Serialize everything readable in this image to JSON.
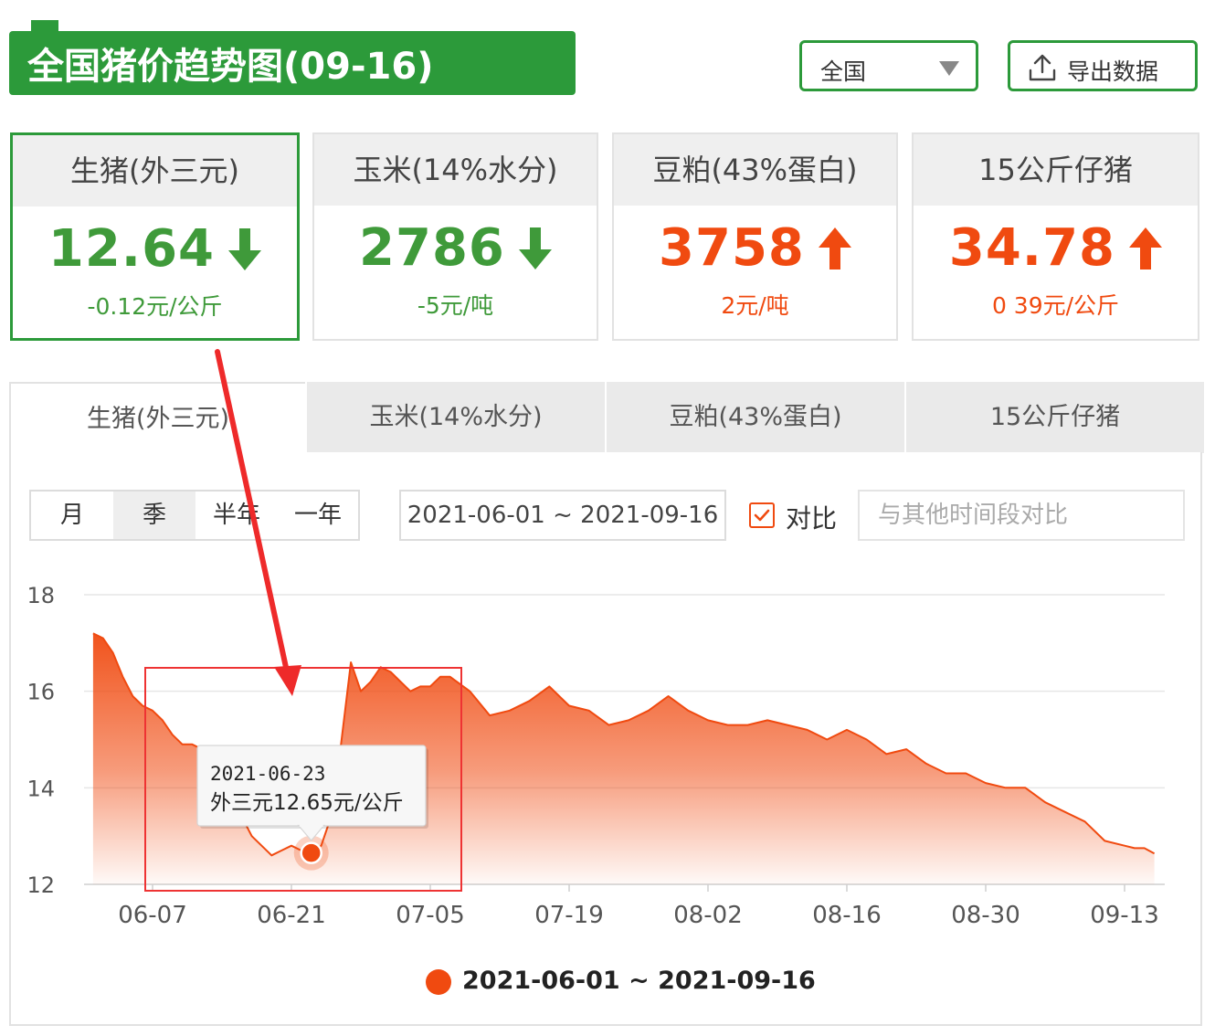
{
  "header": {
    "title": "全国猪价趋势图(09-16)",
    "region": "全国",
    "export_label": "导出数据"
  },
  "cards": [
    {
      "name": "生猪(外三元)",
      "value": "12.64",
      "change": "-0.12元/公斤",
      "direction": "down",
      "color": "#3f9a3a"
    },
    {
      "name": "玉米(14%水分)",
      "value": "2786",
      "change": "-5元/吨",
      "direction": "down",
      "color": "#3f9a3a"
    },
    {
      "name": "豆粕(43%蛋白)",
      "value": "3758",
      "change": "2元/吨",
      "direction": "up",
      "color": "#f04a10"
    },
    {
      "name": "15公斤仔猪",
      "value": "34.78",
      "change": "0 39元/公斤",
      "direction": "up",
      "color": "#f04a10"
    }
  ],
  "tabs": [
    "生猪(外三元)",
    "玉米(14%水分)",
    "豆粕(43%蛋白)",
    "15公斤仔猪"
  ],
  "controls": {
    "ranges": [
      "月",
      "季",
      "半年",
      "一年"
    ],
    "active_range": "季",
    "date_range": "2021-06-01 ~ 2021-09-16",
    "compare_label": "对比",
    "compare_placeholder": "与其他时间段对比"
  },
  "colors": {
    "brand": "#2c9a3a",
    "series": "#f04a10"
  },
  "chart_data": {
    "type": "area",
    "ylim": [
      12,
      18
    ],
    "yticks": [
      12,
      14,
      16,
      18
    ],
    "xtick_labels": [
      "06-07",
      "06-21",
      "07-05",
      "07-19",
      "08-02",
      "08-16",
      "08-30",
      "09-13"
    ],
    "xtick_dates": [
      "2021-06-07",
      "2021-06-21",
      "2021-07-05",
      "2021-07-19",
      "2021-08-02",
      "2021-08-16",
      "2021-08-30",
      "2021-09-13"
    ],
    "grid": true,
    "legend": "bottom",
    "series": [
      {
        "name": "2021-06-01 ~ 2021-09-16",
        "color": "#f04a10",
        "x": [
          "2021-06-01",
          "2021-06-02",
          "2021-06-03",
          "2021-06-04",
          "2021-06-05",
          "2021-06-06",
          "2021-06-07",
          "2021-06-08",
          "2021-06-09",
          "2021-06-10",
          "2021-06-11",
          "2021-06-12",
          "2021-06-13",
          "2021-06-14",
          "2021-06-15",
          "2021-06-16",
          "2021-06-17",
          "2021-06-18",
          "2021-06-19",
          "2021-06-20",
          "2021-06-21",
          "2021-06-22",
          "2021-06-23",
          "2021-06-24",
          "2021-06-25",
          "2021-06-26",
          "2021-06-27",
          "2021-06-28",
          "2021-06-29",
          "2021-06-30",
          "2021-07-01",
          "2021-07-02",
          "2021-07-03",
          "2021-07-04",
          "2021-07-05",
          "2021-07-06",
          "2021-07-07",
          "2021-07-09",
          "2021-07-11",
          "2021-07-13",
          "2021-07-15",
          "2021-07-17",
          "2021-07-19",
          "2021-07-21",
          "2021-07-23",
          "2021-07-25",
          "2021-07-27",
          "2021-07-29",
          "2021-07-31",
          "2021-08-02",
          "2021-08-04",
          "2021-08-06",
          "2021-08-08",
          "2021-08-10",
          "2021-08-12",
          "2021-08-14",
          "2021-08-16",
          "2021-08-18",
          "2021-08-20",
          "2021-08-22",
          "2021-08-24",
          "2021-08-26",
          "2021-08-28",
          "2021-08-30",
          "2021-09-01",
          "2021-09-03",
          "2021-09-05",
          "2021-09-07",
          "2021-09-09",
          "2021-09-11",
          "2021-09-13",
          "2021-09-14",
          "2021-09-15",
          "2021-09-16"
        ],
        "y": [
          17.2,
          17.1,
          16.8,
          16.3,
          15.9,
          15.7,
          15.6,
          15.4,
          15.1,
          14.9,
          14.9,
          14.8,
          14.6,
          14.1,
          13.7,
          13.4,
          13.0,
          12.8,
          12.6,
          12.7,
          12.8,
          12.7,
          12.65,
          12.8,
          13.4,
          14.9,
          16.6,
          16.0,
          16.2,
          16.5,
          16.4,
          16.2,
          16.0,
          16.1,
          16.1,
          16.3,
          16.3,
          16.0,
          15.5,
          15.6,
          15.8,
          16.1,
          15.7,
          15.6,
          15.3,
          15.4,
          15.6,
          15.9,
          15.6,
          15.4,
          15.3,
          15.3,
          15.4,
          15.3,
          15.2,
          15.0,
          15.2,
          15.0,
          14.7,
          14.8,
          14.5,
          14.3,
          14.3,
          14.1,
          14.0,
          14.0,
          13.7,
          13.5,
          13.3,
          12.9,
          12.8,
          12.75,
          12.75,
          12.64
        ]
      }
    ],
    "tooltip": {
      "date": "2021-06-23",
      "label": "外三元12.65元/公斤",
      "value": 12.65
    }
  }
}
